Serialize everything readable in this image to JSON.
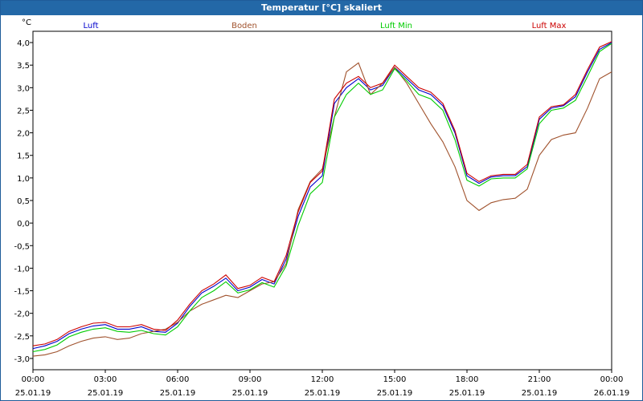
{
  "window": {
    "title": "Temperatur [°C] skaliert"
  },
  "chart_data": {
    "type": "line",
    "title": "Temperatur [°C] skaliert",
    "ylabel": "°C",
    "xlabel": "",
    "ylim": [
      -3.25,
      4.25
    ],
    "yticks": [
      -3.0,
      -2.5,
      -2.0,
      -1.5,
      -1.0,
      -0.5,
      0.0,
      0.5,
      1.0,
      1.5,
      2.0,
      2.5,
      3.0,
      3.5,
      4.0
    ],
    "ytick_labels": [
      "-3,0",
      "-2,5",
      "-2,0",
      "-1,5",
      "-1,0",
      "-0,5",
      "0,0",
      "0,5",
      "1,0",
      "1,5",
      "2,0",
      "2,5",
      "3,0",
      "3,5",
      "4,0"
    ],
    "xlim": [
      0,
      24
    ],
    "xticks": [
      {
        "h": 0,
        "time": "00:00",
        "date": "25.01.19"
      },
      {
        "h": 3,
        "time": "03:00",
        "date": "25.01.19"
      },
      {
        "h": 6,
        "time": "06:00",
        "date": "25.01.19"
      },
      {
        "h": 9,
        "time": "09:00",
        "date": "25.01.19"
      },
      {
        "h": 12,
        "time": "12:00",
        "date": "25.01.19"
      },
      {
        "h": 15,
        "time": "15:00",
        "date": "25.01.19"
      },
      {
        "h": 18,
        "time": "18:00",
        "date": "25.01.19"
      },
      {
        "h": 21,
        "time": "21:00",
        "date": "25.01.19"
      },
      {
        "h": 24,
        "time": "00:00",
        "date": "26.01.19"
      }
    ],
    "grid": true,
    "legend_position": "top",
    "series": [
      {
        "name": "Luft",
        "color": "#0000cc",
        "x": [
          0,
          0.5,
          1,
          1.5,
          2,
          2.5,
          3,
          3.5,
          4,
          4.5,
          5,
          5.5,
          6,
          6.5,
          7,
          7.5,
          8,
          8.5,
          9,
          9.5,
          10,
          10.5,
          11,
          11.5,
          12,
          12.5,
          13,
          13.5,
          14,
          14.5,
          15,
          15.5,
          16,
          16.5,
          17,
          17.5,
          18,
          18.5,
          19,
          19.5,
          20,
          20.5,
          21,
          21.5,
          22,
          22.5,
          23,
          23.5,
          24
        ],
        "values": [
          -2.78,
          -2.72,
          -2.62,
          -2.45,
          -2.35,
          -2.28,
          -2.25,
          -2.35,
          -2.35,
          -2.3,
          -2.4,
          -2.42,
          -2.22,
          -1.85,
          -1.55,
          -1.4,
          -1.22,
          -1.5,
          -1.42,
          -1.25,
          -1.35,
          -0.8,
          0.15,
          0.8,
          1.05,
          2.65,
          3.0,
          3.2,
          2.95,
          3.05,
          3.45,
          3.2,
          2.95,
          2.85,
          2.6,
          2.0,
          1.05,
          0.88,
          1.02,
          1.05,
          1.05,
          1.25,
          2.3,
          2.55,
          2.6,
          2.8,
          3.35,
          3.85,
          4.0
        ]
      },
      {
        "name": "Boden",
        "color": "#a0522d",
        "x": [
          0,
          0.5,
          1,
          1.5,
          2,
          2.5,
          3,
          3.5,
          4,
          4.5,
          5,
          5.5,
          6,
          6.5,
          7,
          7.5,
          8,
          8.5,
          9,
          9.5,
          10,
          10.5,
          11,
          11.5,
          12,
          12.5,
          13,
          13.5,
          14,
          14.5,
          15,
          15.5,
          16,
          16.5,
          17,
          17.5,
          18,
          18.5,
          19,
          19.5,
          20,
          20.5,
          21,
          21.5,
          22,
          22.5,
          23,
          23.5,
          24
        ],
        "values": [
          -2.95,
          -2.92,
          -2.85,
          -2.72,
          -2.62,
          -2.55,
          -2.52,
          -2.58,
          -2.55,
          -2.45,
          -2.4,
          -2.35,
          -2.2,
          -1.95,
          -1.8,
          -1.7,
          -1.6,
          -1.65,
          -1.5,
          -1.35,
          -1.3,
          -0.9,
          0.3,
          0.92,
          1.2,
          2.35,
          3.35,
          3.55,
          2.85,
          3.1,
          3.45,
          3.1,
          2.65,
          2.2,
          1.8,
          1.25,
          0.5,
          0.28,
          0.45,
          0.52,
          0.55,
          0.75,
          1.5,
          1.85,
          1.95,
          2.0,
          2.55,
          3.2,
          3.35
        ]
      },
      {
        "name": "Luft Min",
        "color": "#00cc00",
        "x": [
          0,
          0.5,
          1,
          1.5,
          2,
          2.5,
          3,
          3.5,
          4,
          4.5,
          5,
          5.5,
          6,
          6.5,
          7,
          7.5,
          8,
          8.5,
          9,
          9.5,
          10,
          10.5,
          11,
          11.5,
          12,
          12.5,
          13,
          13.5,
          14,
          14.5,
          15,
          15.5,
          16,
          16.5,
          17,
          17.5,
          18,
          18.5,
          19,
          19.5,
          20,
          20.5,
          21,
          21.5,
          22,
          22.5,
          23,
          23.5,
          24
        ],
        "values": [
          -2.85,
          -2.8,
          -2.7,
          -2.52,
          -2.42,
          -2.35,
          -2.32,
          -2.4,
          -2.42,
          -2.38,
          -2.45,
          -2.48,
          -2.3,
          -1.95,
          -1.65,
          -1.5,
          -1.3,
          -1.55,
          -1.48,
          -1.32,
          -1.42,
          -0.95,
          -0.05,
          0.65,
          0.9,
          2.35,
          2.85,
          3.1,
          2.85,
          2.95,
          3.42,
          3.15,
          2.85,
          2.75,
          2.5,
          1.85,
          0.95,
          0.82,
          0.98,
          1.0,
          1.0,
          1.2,
          2.2,
          2.5,
          2.55,
          2.72,
          3.25,
          3.8,
          3.98
        ]
      },
      {
        "name": "Luft Max",
        "color": "#cc0000",
        "x": [
          0,
          0.5,
          1,
          1.5,
          2,
          2.5,
          3,
          3.5,
          4,
          4.5,
          5,
          5.5,
          6,
          6.5,
          7,
          7.5,
          8,
          8.5,
          9,
          9.5,
          10,
          10.5,
          11,
          11.5,
          12,
          12.5,
          13,
          13.5,
          14,
          14.5,
          15,
          15.5,
          16,
          16.5,
          17,
          17.5,
          18,
          18.5,
          19,
          19.5,
          20,
          20.5,
          21,
          21.5,
          22,
          22.5,
          23,
          23.5,
          24
        ],
        "values": [
          -2.72,
          -2.68,
          -2.58,
          -2.4,
          -2.3,
          -2.22,
          -2.2,
          -2.3,
          -2.3,
          -2.25,
          -2.35,
          -2.38,
          -2.15,
          -1.8,
          -1.5,
          -1.35,
          -1.15,
          -1.45,
          -1.38,
          -1.2,
          -1.3,
          -0.72,
          0.25,
          0.9,
          1.15,
          2.75,
          3.1,
          3.25,
          3.0,
          3.1,
          3.5,
          3.25,
          3.0,
          2.9,
          2.65,
          2.05,
          1.1,
          0.92,
          1.05,
          1.08,
          1.08,
          1.3,
          2.35,
          2.58,
          2.62,
          2.85,
          3.4,
          3.9,
          4.02
        ]
      }
    ]
  }
}
